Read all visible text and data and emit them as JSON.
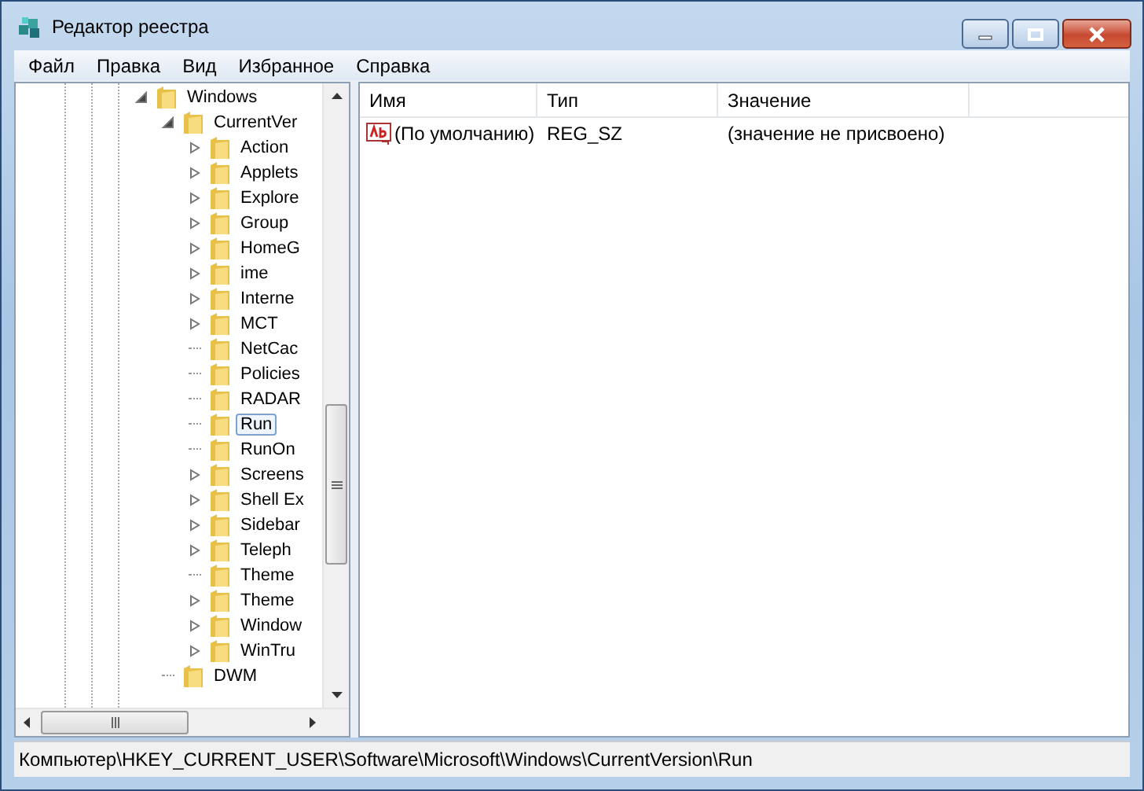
{
  "window": {
    "title": "Редактор реестра"
  },
  "menu": [
    "Файл",
    "Правка",
    "Вид",
    "Избранное",
    "Справка"
  ],
  "tree": [
    {
      "label": "Windows",
      "has_children": true,
      "expanded": true,
      "selected": false,
      "children": [
        {
          "label": "CurrentVer",
          "has_children": true,
          "expanded": true,
          "selected": false,
          "children": [
            {
              "label": "Action",
              "has_children": true,
              "expanded": false,
              "selected": false
            },
            {
              "label": "Applets",
              "has_children": true,
              "expanded": false,
              "selected": false
            },
            {
              "label": "Explore",
              "has_children": true,
              "expanded": false,
              "selected": false
            },
            {
              "label": "Group",
              "has_children": true,
              "expanded": false,
              "selected": false
            },
            {
              "label": "HomeG",
              "has_children": true,
              "expanded": false,
              "selected": false
            },
            {
              "label": "ime",
              "has_children": true,
              "expanded": false,
              "selected": false
            },
            {
              "label": "Interne",
              "has_children": true,
              "expanded": false,
              "selected": false
            },
            {
              "label": "MCT",
              "has_children": true,
              "expanded": false,
              "selected": false
            },
            {
              "label": "NetCac",
              "has_children": false,
              "selected": false
            },
            {
              "label": "Policies",
              "has_children": false,
              "selected": false
            },
            {
              "label": "RADAR",
              "has_children": false,
              "selected": false
            },
            {
              "label": "Run",
              "has_children": false,
              "selected": true
            },
            {
              "label": "RunOn",
              "has_children": false,
              "selected": false
            },
            {
              "label": "Screens",
              "has_children": true,
              "expanded": false,
              "selected": false
            },
            {
              "label": "Shell Ex",
              "has_children": true,
              "expanded": false,
              "selected": false
            },
            {
              "label": "Sidebar",
              "has_children": true,
              "expanded": false,
              "selected": false
            },
            {
              "label": "Teleph",
              "has_children": true,
              "expanded": false,
              "selected": false
            },
            {
              "label": "Theme",
              "has_children": false,
              "selected": false
            },
            {
              "label": "Theme",
              "has_children": true,
              "expanded": false,
              "selected": false
            },
            {
              "label": "Window",
              "has_children": true,
              "expanded": false,
              "selected": false
            },
            {
              "label": "WinTru",
              "has_children": true,
              "expanded": false,
              "selected": false
            }
          ]
        },
        {
          "label": "DWM",
          "has_children": false,
          "selected": false
        }
      ]
    }
  ],
  "table": {
    "columns": [
      "Имя",
      "Тип",
      "Значение"
    ],
    "rows": [
      {
        "cells": [
          "(По умолчанию)",
          "REG_SZ",
          "(значение не присвоено)"
        ],
        "selected": false
      }
    ]
  },
  "status_bar": "Компьютер\\HKEY_CURRENT_USER\\Software\\Microsoft\\Windows\\CurrentVersion\\Run"
}
